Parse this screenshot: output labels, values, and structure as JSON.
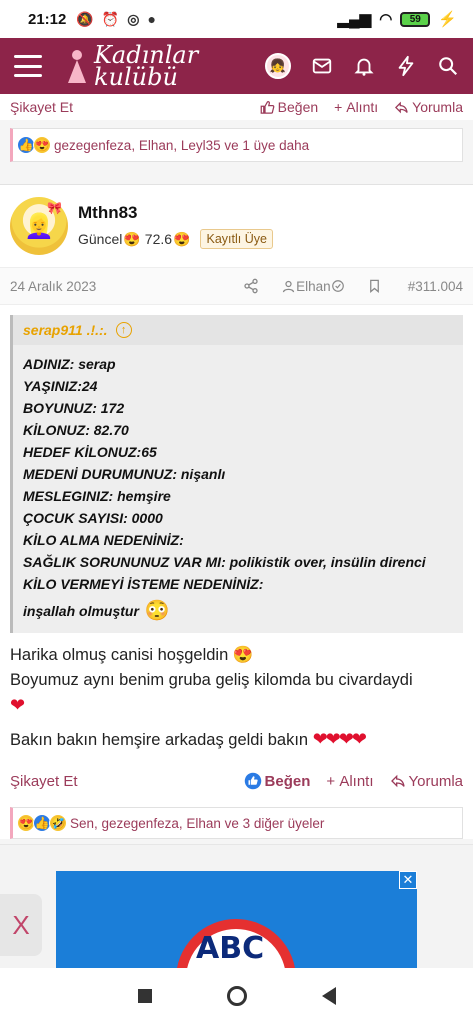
{
  "status_bar": {
    "time": "21:12",
    "battery": "59"
  },
  "app": {
    "logo_line1": "Kadınlar",
    "logo_line2": "kulübü"
  },
  "prev_post": {
    "report": "Şikayet Et",
    "like": "Beğen",
    "quote": "Alıntı",
    "reply": "Yorumla",
    "reactions_text": "gezegenfeza, Elhan, Leyl35 ve 1 üye daha"
  },
  "post": {
    "username": "Mthn83",
    "status_prefix": "Güncel",
    "status_value": "72.6",
    "badge": "Kayıtlı Üye",
    "date": "24 Aralık 2023",
    "mention": "Elhan",
    "post_number": "#311.004",
    "quote": {
      "author": "serap911 .!.:.",
      "lines": [
        "ADINIZ: serap",
        "YAŞINIZ:24",
        "BOYUNUZ: 172",
        "KİLONUZ: 82.70",
        "HEDEF KİLONUZ:65",
        "MEDENİ DURUMUNUZ: nişanlı",
        "MESLEGINIZ: hemşire",
        "ÇOCUK SAYISI: 0000",
        "KİLO ALMA NEDENİNİZ:",
        "SAĞLIK SORUNUNUZ VAR MI: polikistik over, insülin direnci",
        "KİLO VERMEYİ İSTEME NEDENİNİZ:",
        "inşallah olmuştur"
      ]
    },
    "message": {
      "line1": "Harika olmuş canisi hoşgeldin",
      "line2": "Boyumuz aynı benim gruba geliş kilomda bu civardaydi",
      "line3": "Bakın bakın hemşire arkadaş geldi bakın"
    },
    "actions": {
      "report": "Şikayet Et",
      "like": "Beğen",
      "quote": "Alıntı",
      "reply": "Yorumla"
    },
    "reactions_text": "Sen, gezegenfeza, Elhan ve 3 diğer üyeler"
  },
  "ad": {
    "logo_text": "ABC",
    "side_close": "X"
  },
  "colors": {
    "brand": "#8d2449",
    "link": "#9b3b5a",
    "like_blue": "#2b7be4"
  }
}
